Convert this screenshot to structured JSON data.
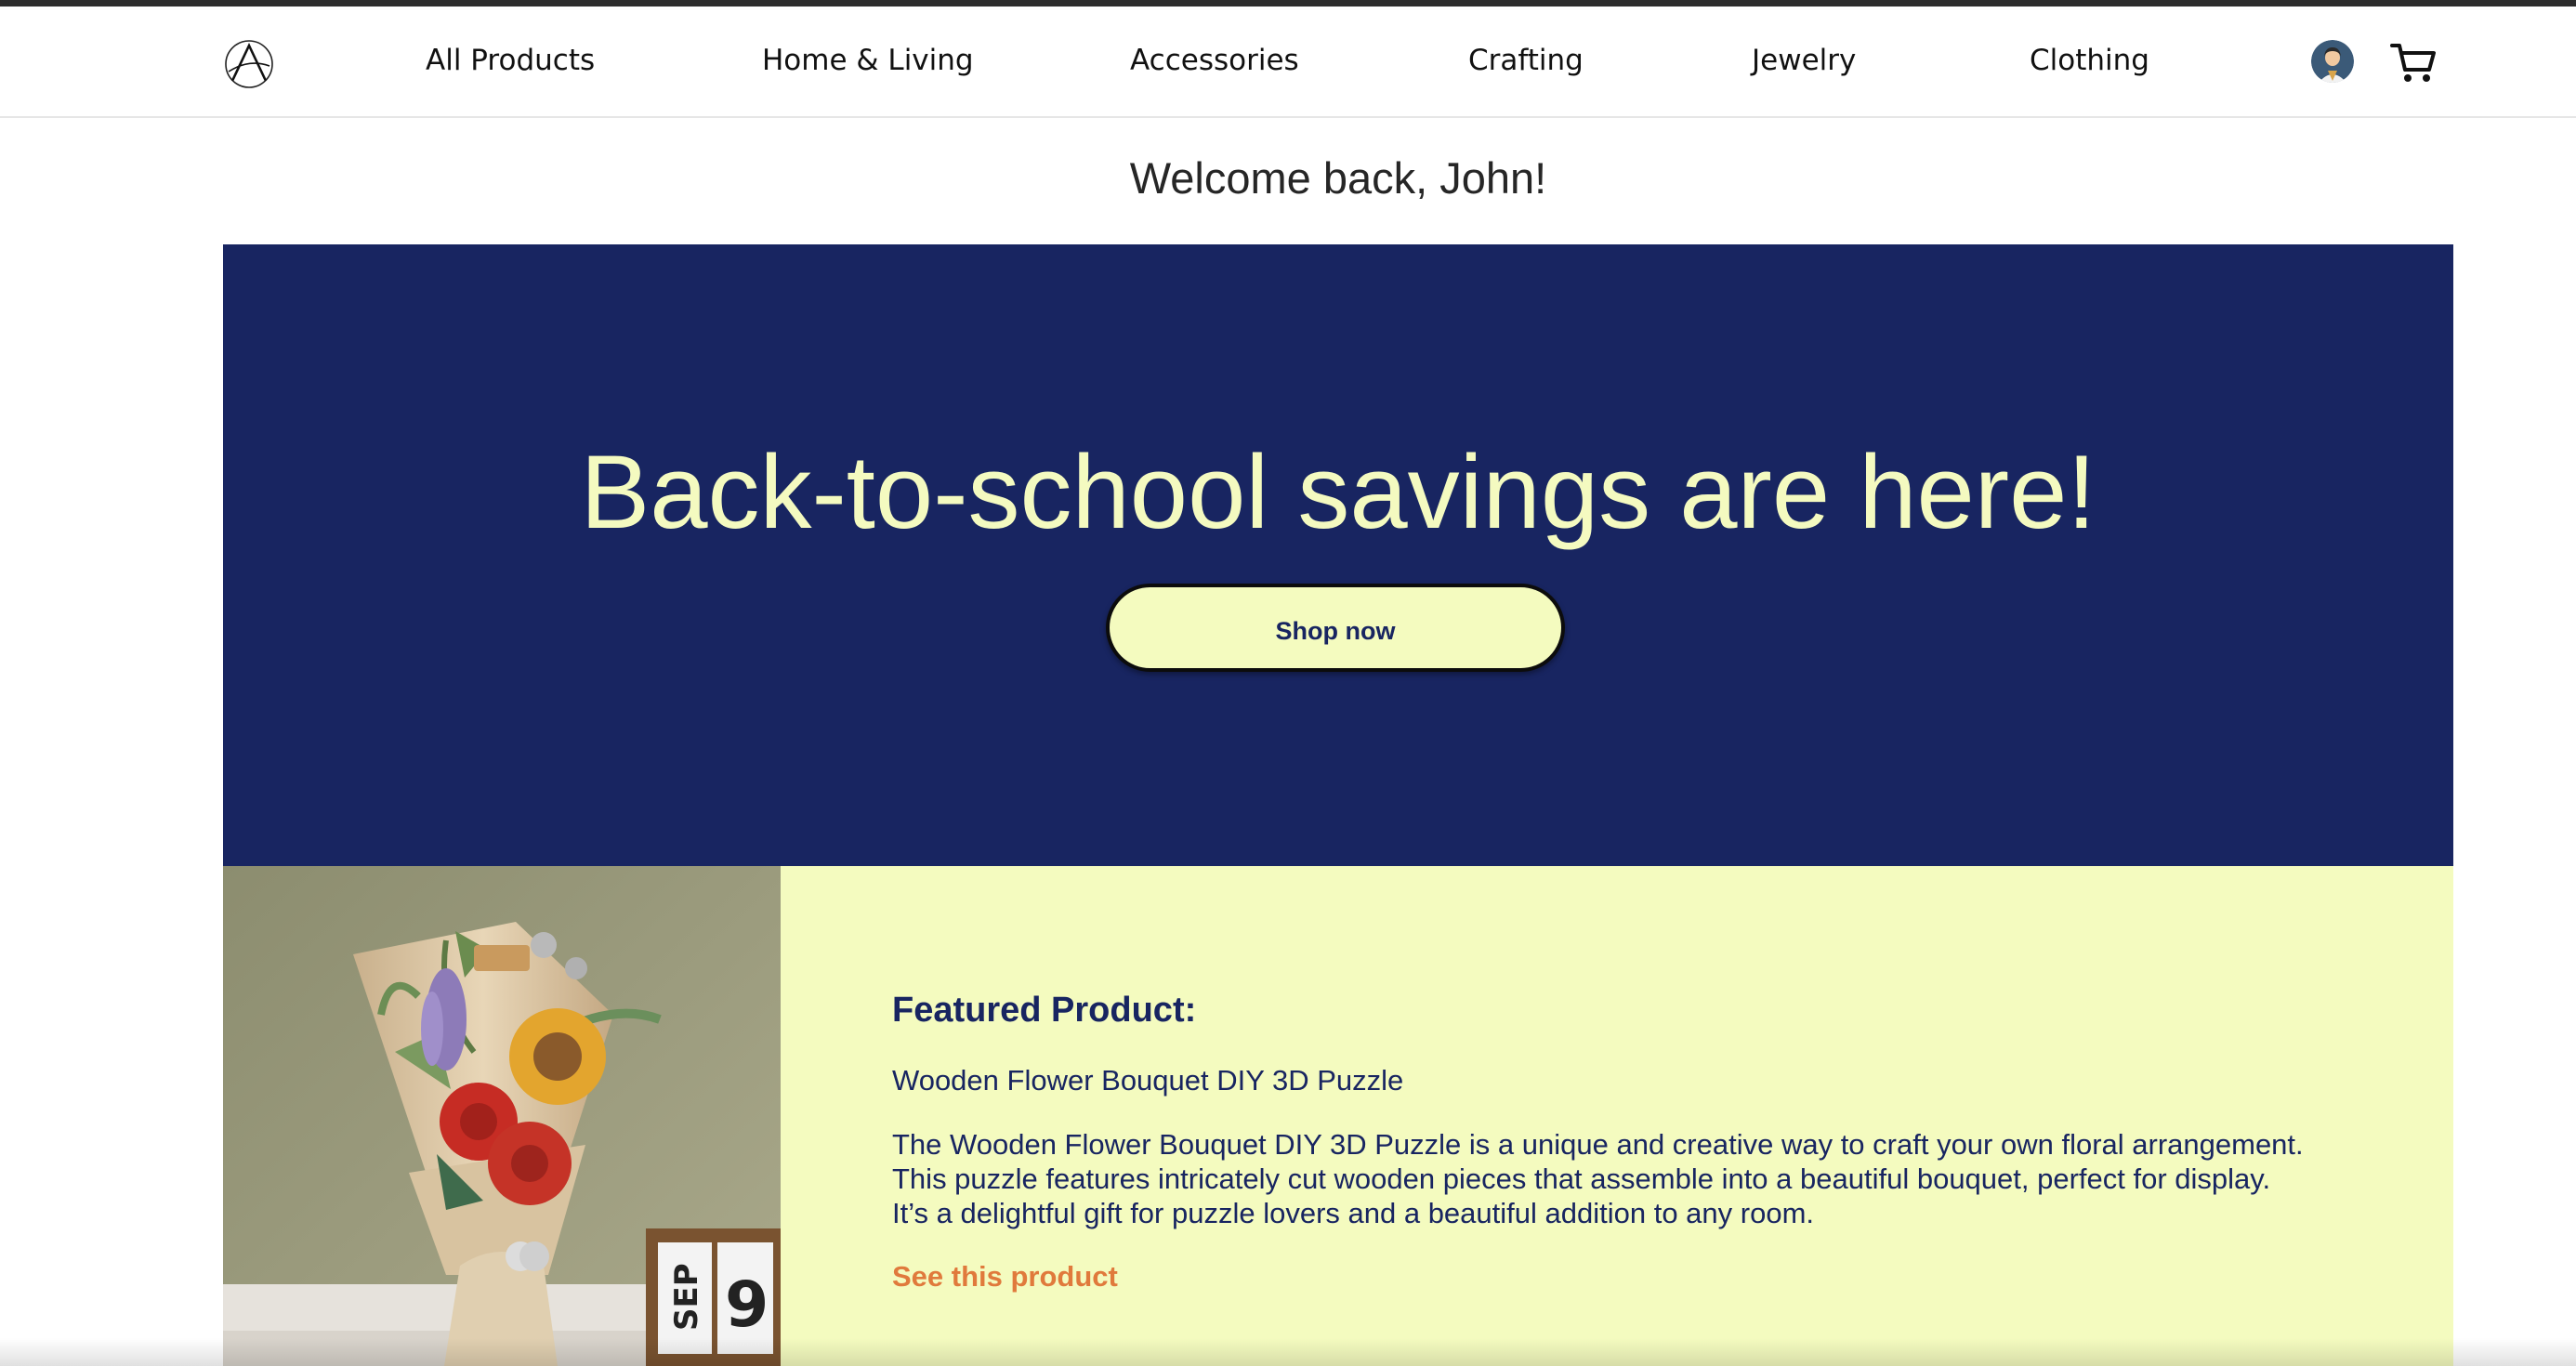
{
  "nav": {
    "logo_icon": "brand-logo-icon",
    "items": [
      {
        "label": "All Products"
      },
      {
        "label": "Home & Living"
      },
      {
        "label": "Accessories"
      },
      {
        "label": "Crafting"
      },
      {
        "label": "Jewelry"
      },
      {
        "label": "Clothing"
      }
    ],
    "avatar_icon": "user-avatar-icon",
    "cart_icon": "shopping-cart-icon"
  },
  "welcome": {
    "text": "Welcome back, John!"
  },
  "hero": {
    "headline": "Back-to-school savings are here!",
    "button_label": "Shop now",
    "background_color": "#182561",
    "text_color": "#f4fac0"
  },
  "featured": {
    "heading": "Featured Product:",
    "product_name": "Wooden Flower Bouquet DIY 3D Puzzle",
    "description": "The Wooden Flower Bouquet DIY 3D Puzzle is a unique and creative way to craft your own floral arrangement. This puzzle features intricately cut wooden pieces that assemble into a beautiful bouquet, perfect for display. It’s a delightful gift for puzzle lovers and a beautiful addition to any room.",
    "link_label": "See this product",
    "background_color": "#f4fbbf",
    "link_color": "#e07a3c",
    "image": {
      "calendar_month": "SEP",
      "calendar_day": "9"
    }
  }
}
